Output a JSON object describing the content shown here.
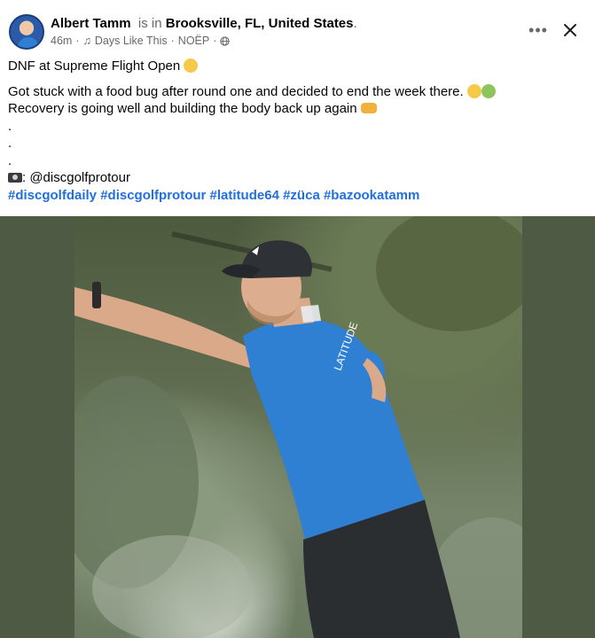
{
  "post": {
    "author": "Albert Tamm",
    "is_in": "is in",
    "location": "Brooksville, FL, United States",
    "location_suffix": ".",
    "time": "46m",
    "separator": "·",
    "music_icon": "music-note-icon",
    "song": "Days Like This",
    "artist": "NOËP",
    "privacy_icon": "globe-icon"
  },
  "controls": {
    "more_label": "•••",
    "close_icon": "close-icon"
  },
  "body": {
    "line1": "DNF at Supreme Flight Open",
    "line2": "Got stuck with a food bug after round one and decided to end the week there.",
    "line3": "Recovery is going well and building the body back up again",
    "dot1": ".",
    "dot2": ".",
    "dot3": ".",
    "credit_icon": "camera-icon",
    "credit": ": @discgolfprotour",
    "hashtags": [
      "#discgolfdaily",
      "#discgolfprotour",
      "#latitude64",
      "#züca",
      "#bazookatamm"
    ]
  },
  "colors": {
    "link": "#216fdb",
    "muted": "#65676b",
    "photo_bg": "#4f5a44",
    "shirt": "#2f7fd3"
  }
}
